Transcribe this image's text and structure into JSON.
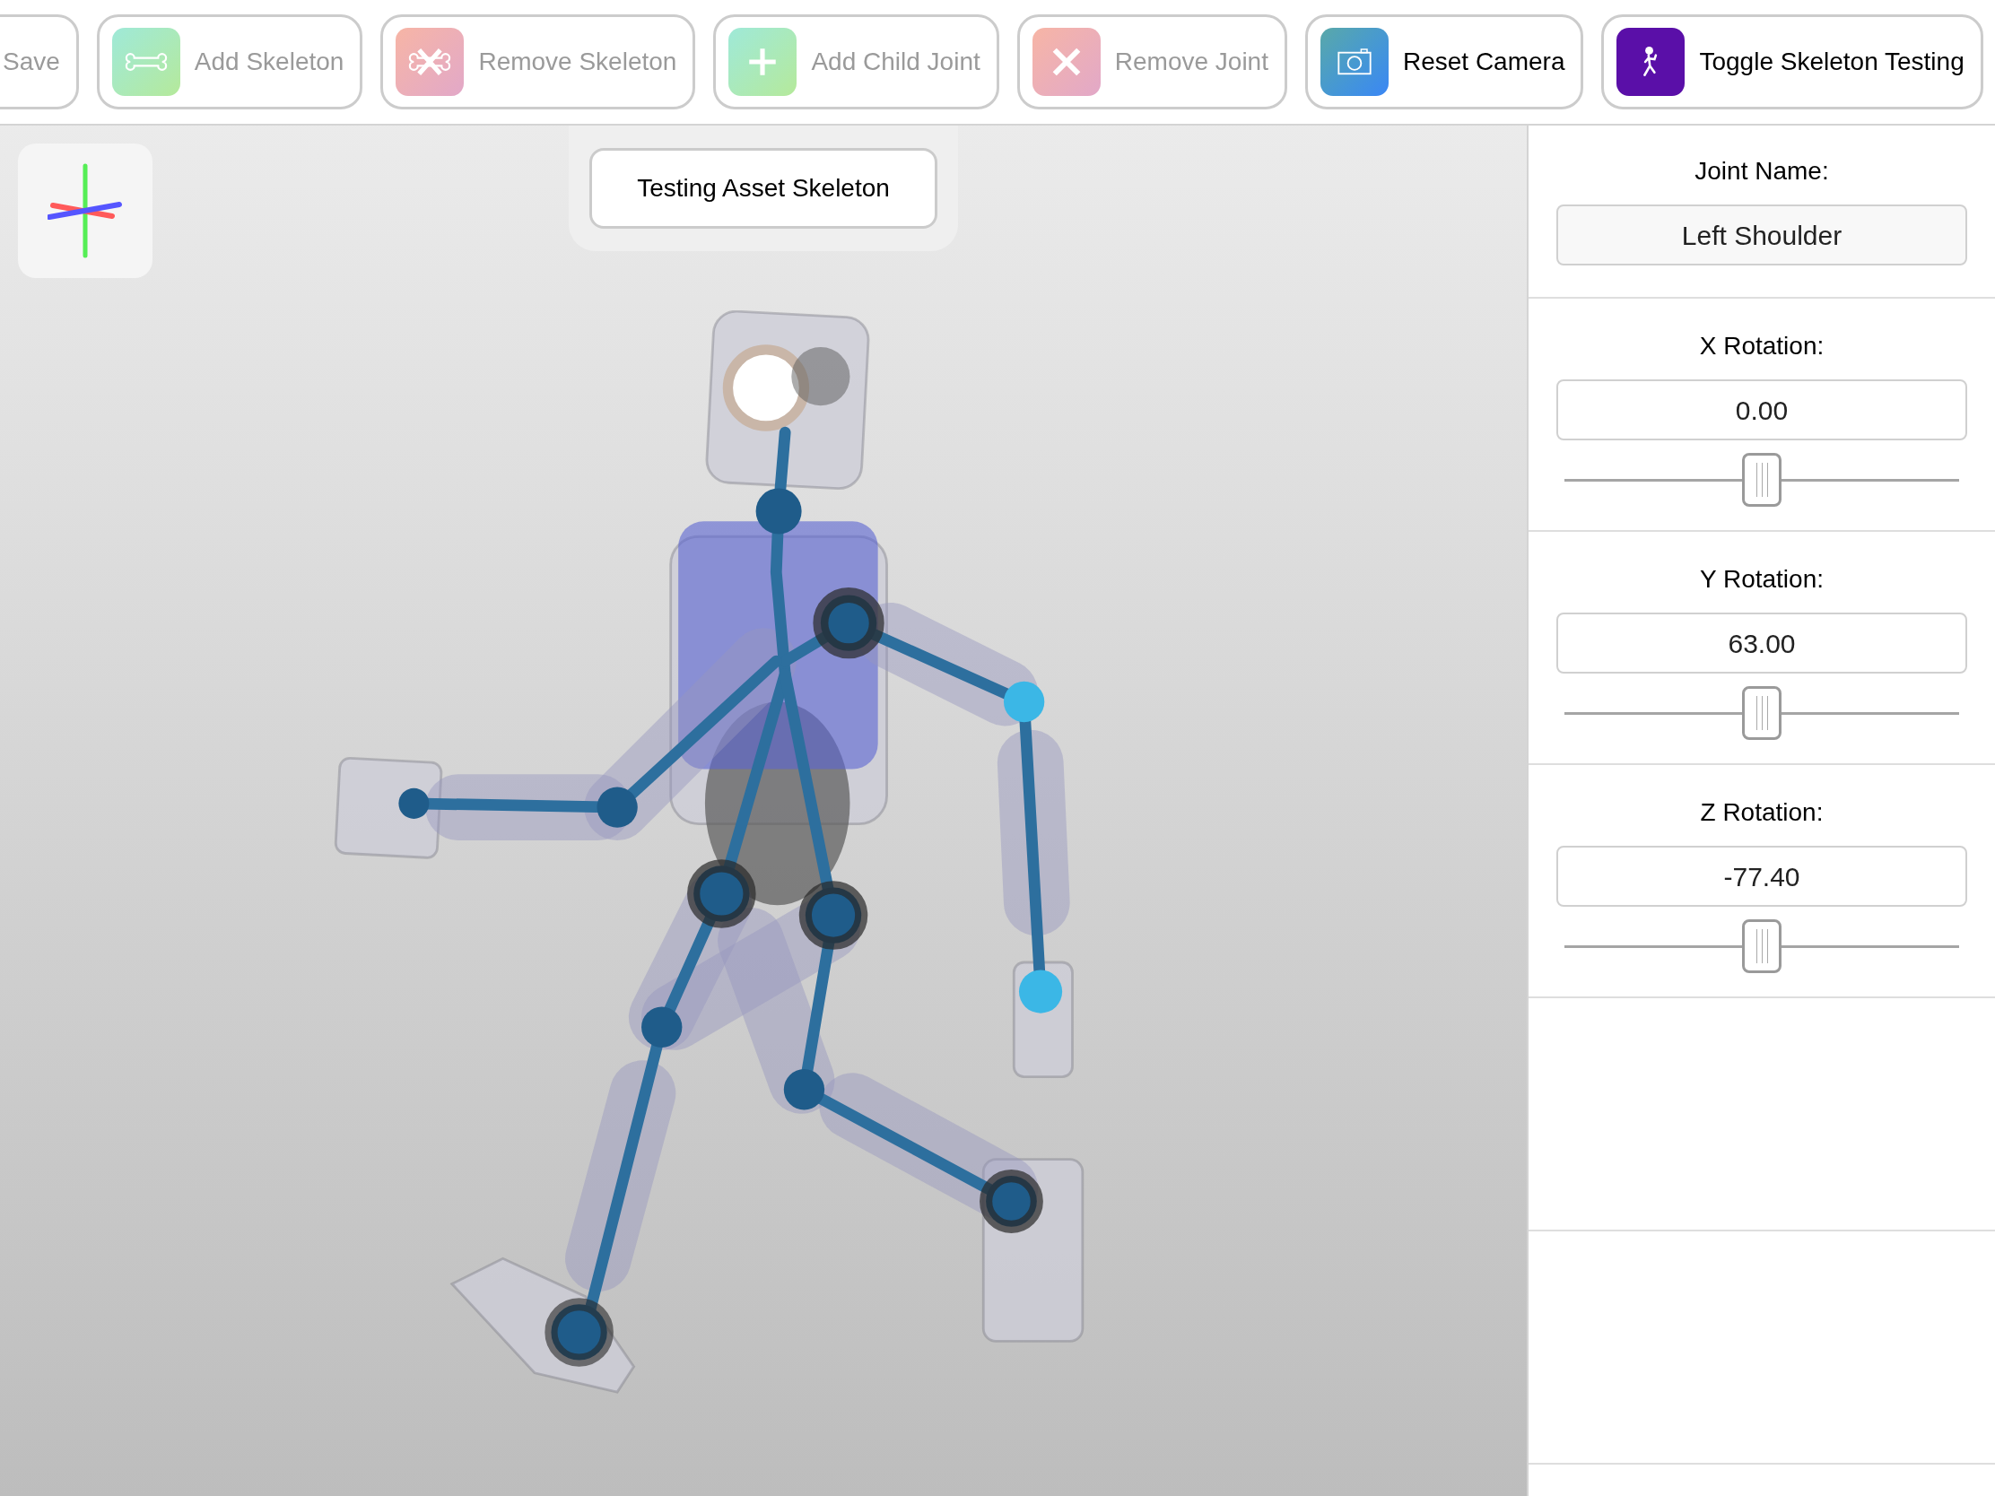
{
  "toolbar": [
    {
      "label": "Save",
      "kind": "text",
      "disabled": true
    },
    {
      "label": "Add Skeleton",
      "kind": "bone",
      "disabled": true
    },
    {
      "label": "Remove Skeleton",
      "kind": "bonecross",
      "disabled": true
    },
    {
      "label": "Add Child Joint",
      "kind": "plus",
      "disabled": true
    },
    {
      "label": "Remove Joint",
      "kind": "cross",
      "disabled": true
    },
    {
      "label": "Reset Camera",
      "kind": "camera",
      "disabled": false
    },
    {
      "label": "Toggle Skeleton Testing",
      "kind": "runner",
      "disabled": false
    }
  ],
  "viewport": {
    "banner": "Testing Asset Skeleton"
  },
  "inspector": {
    "joint_name_label": "Joint Name:",
    "joint_name": "Left Shoulder",
    "rotations": [
      {
        "label": "X Rotation:",
        "value": "0.00",
        "level": 0.5
      },
      {
        "label": "Y Rotation:",
        "value": "63.00",
        "level": 0.5
      },
      {
        "label": "Z Rotation:",
        "value": "-77.40",
        "level": 0.5
      }
    ]
  }
}
